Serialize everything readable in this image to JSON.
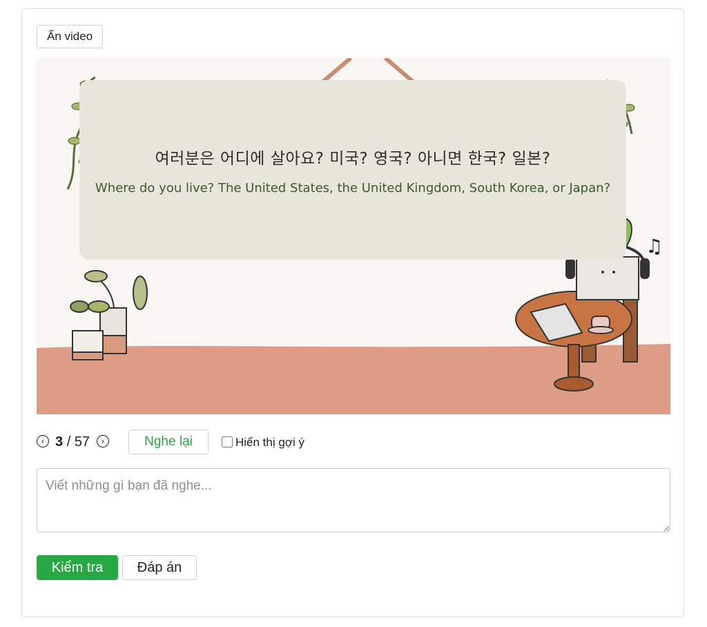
{
  "toggle_video_label": "Ẩn video",
  "video": {
    "subtitle_korean": "여러분은 어디에 살아요? 미국? 영국? 아니면 한국? 일본?",
    "subtitle_english": "Where do you live? The United States, the United Kingdom, South Korea, or Japan?"
  },
  "controls": {
    "current": "3",
    "separator": "/",
    "total": "57",
    "replay_label": "Nghe lại",
    "hint_label": "Hiển thị gợi ý",
    "hint_checked": false
  },
  "answer": {
    "placeholder": "Viết những gì bạn đã nghe...",
    "value": ""
  },
  "actions": {
    "check_label": "Kiểm tra",
    "answer_label": "Đáp án"
  },
  "colors": {
    "accent_green": "#28a745",
    "floor": "#dc9c85",
    "wall": "#f8f6f2",
    "subtitle_panel": "#e8e6da"
  }
}
